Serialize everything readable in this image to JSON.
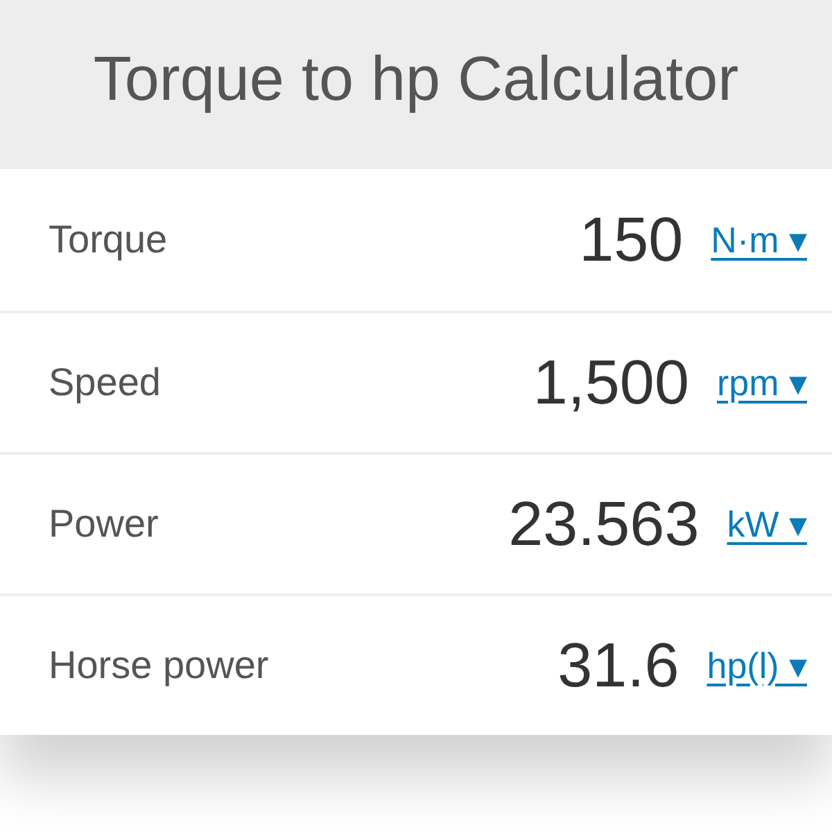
{
  "title": "Torque to hp Calculator",
  "rows": [
    {
      "label": "Torque",
      "value": "150",
      "unit": "N·m",
      "arrow": "▾"
    },
    {
      "label": "Speed",
      "value": "1,500",
      "unit": "rpm",
      "arrow": "▾"
    },
    {
      "label": "Power",
      "value": "23.563",
      "unit": "kW",
      "arrow": "▾"
    },
    {
      "label": "Horse power",
      "value": "31.6",
      "unit": "hp(l)",
      "arrow": "▾"
    }
  ]
}
